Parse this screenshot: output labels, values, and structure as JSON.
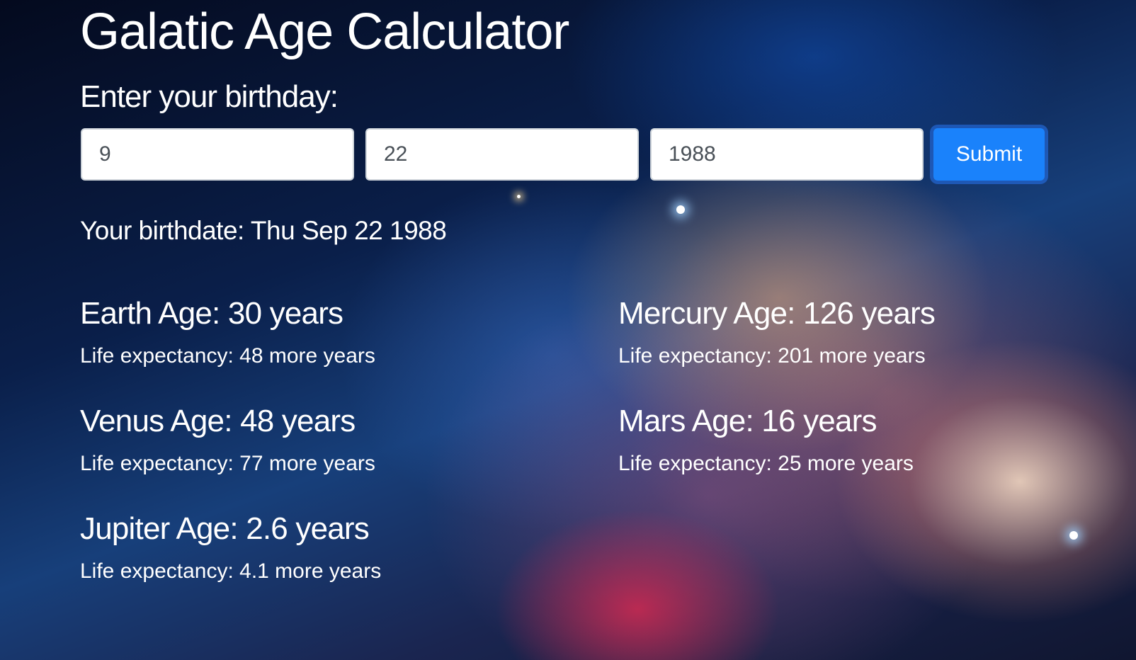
{
  "title": "Galatic Age Calculator",
  "form": {
    "label": "Enter your birthday:",
    "month_value": "9",
    "day_value": "22",
    "year_value": "1988",
    "submit_label": "Submit"
  },
  "birthdate": "Your birthdate: Thu Sep 22 1988",
  "planets": [
    {
      "age": "Earth Age: 30 years",
      "life": "Life expectancy: 48 more years"
    },
    {
      "age": "Mercury Age: 126 years",
      "life": "Life expectancy: 201 more years"
    },
    {
      "age": "Venus Age: 48 years",
      "life": "Life expectancy: 77 more years"
    },
    {
      "age": "Mars Age: 16 years",
      "life": "Life expectancy: 25 more years"
    },
    {
      "age": "Jupiter Age: 2.6 years",
      "life": "Life expectancy: 4.1 more years"
    }
  ],
  "colors": {
    "button": "#1a82fb",
    "text": "#ffffff"
  }
}
